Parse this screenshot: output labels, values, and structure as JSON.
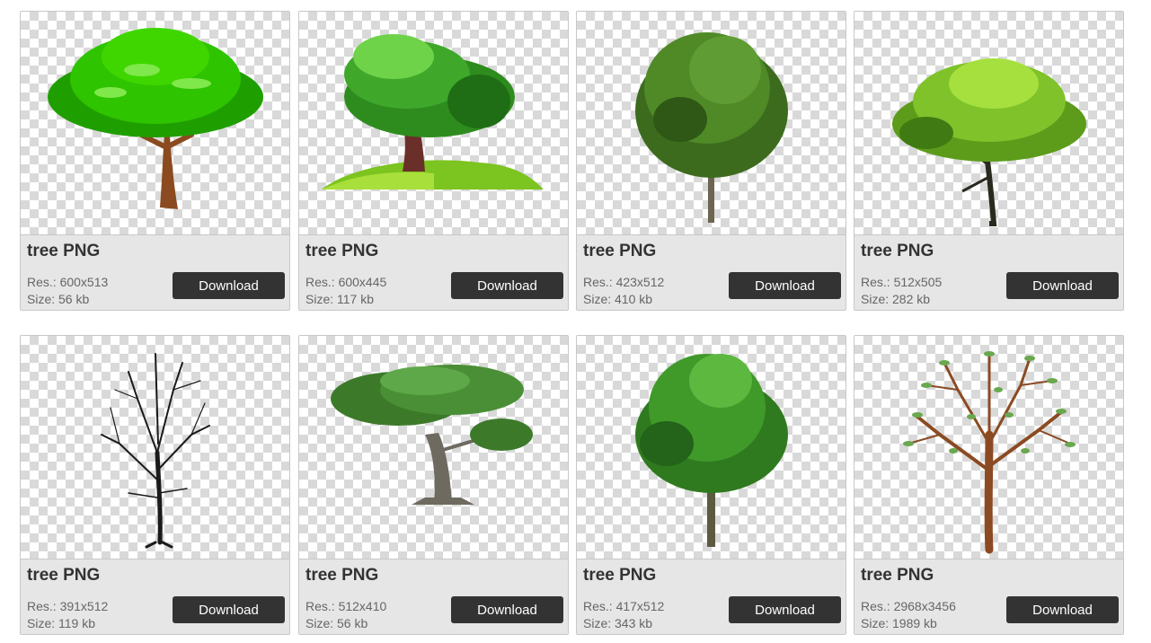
{
  "cards": [
    {
      "title": "tree PNG",
      "res_label": "Res.:",
      "res": "600x513",
      "size_label": "Size:",
      "size": "56 kb",
      "button": "Download",
      "image_icon": "cartoon-tree-icon"
    },
    {
      "title": "tree PNG",
      "res_label": "Res.:",
      "res": "600x445",
      "size_label": "Size:",
      "size": "117 kb",
      "button": "Download",
      "image_icon": "cartoon-tree-on-hill-icon"
    },
    {
      "title": "tree PNG",
      "res_label": "Res.:",
      "res": "423x512",
      "size_label": "Size:",
      "size": "410 kb",
      "button": "Download",
      "image_icon": "photo-tree-icon"
    },
    {
      "title": "tree PNG",
      "res_label": "Res.:",
      "res": "512x505",
      "size_label": "Size:",
      "size": "282 kb",
      "button": "Download",
      "image_icon": "light-green-tree-icon"
    },
    {
      "title": "tree PNG",
      "res_label": "Res.:",
      "res": "391x512",
      "size_label": "Size:",
      "size": "119 kb",
      "button": "Download",
      "image_icon": "bare-tree-icon"
    },
    {
      "title": "tree PNG",
      "res_label": "Res.:",
      "res": "512x410",
      "size_label": "Size:",
      "size": "56 kb",
      "button": "Download",
      "image_icon": "bonsai-tree-icon"
    },
    {
      "title": "tree PNG",
      "res_label": "Res.:",
      "res": "417x512",
      "size_label": "Size:",
      "size": "343 kb",
      "button": "Download",
      "image_icon": "leafy-tree-icon"
    },
    {
      "title": "tree PNG",
      "res_label": "Res.:",
      "res": "2968x3456",
      "size_label": "Size:",
      "size": "1989 kb",
      "button": "Download",
      "image_icon": "sparse-leaf-tree-icon"
    }
  ],
  "colors": {
    "card_bg": "#e6e6e6",
    "button_bg": "#333333",
    "button_text": "#ffffff",
    "title_text": "#333333",
    "meta_text": "#666666"
  }
}
